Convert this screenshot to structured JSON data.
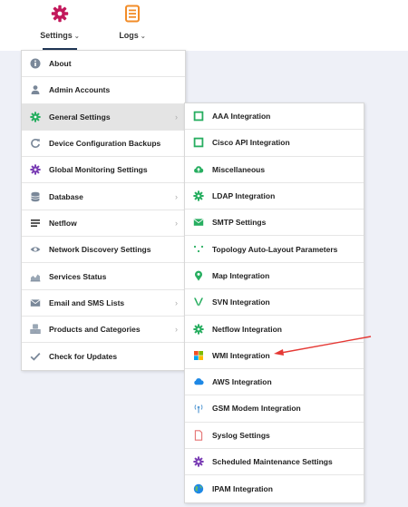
{
  "topnav": {
    "settings_label": "Settings",
    "logs_label": "Logs",
    "settings_icon": "gear-icon",
    "logs_icon": "document-icon",
    "accent_color": "#c2185b",
    "logs_color": "#f28c28"
  },
  "main_menu": {
    "items": [
      {
        "label": "About",
        "icon": "info-icon",
        "has_submenu": false
      },
      {
        "label": "Admin Accounts",
        "icon": "user-icon",
        "has_submenu": false
      },
      {
        "label": "General Settings",
        "icon": "gear-icon",
        "has_submenu": true,
        "selected": true
      },
      {
        "label": "Device Configuration Backups",
        "icon": "refresh-icon",
        "has_submenu": false
      },
      {
        "label": "Global Monitoring Settings",
        "icon": "gear-icon",
        "has_submenu": false
      },
      {
        "label": "Database",
        "icon": "database-icon",
        "has_submenu": true
      },
      {
        "label": "Netflow",
        "icon": "netflow-icon",
        "has_submenu": true
      },
      {
        "label": "Network Discovery Settings",
        "icon": "eye-icon",
        "has_submenu": false
      },
      {
        "label": "Services Status",
        "icon": "chart-icon",
        "has_submenu": false
      },
      {
        "label": "Email and SMS Lists",
        "icon": "envelope-icon",
        "has_submenu": true
      },
      {
        "label": "Products and Categories",
        "icon": "cubes-icon",
        "has_submenu": true
      },
      {
        "label": "Check for Updates",
        "icon": "check-icon",
        "has_submenu": false
      }
    ]
  },
  "sub_menu": {
    "items": [
      {
        "label": "AAA Integration",
        "icon": "square-icon"
      },
      {
        "label": "Cisco API Integration",
        "icon": "square-icon"
      },
      {
        "label": "Miscellaneous",
        "icon": "cloud-upload-icon"
      },
      {
        "label": "LDAP Integration",
        "icon": "gear-icon"
      },
      {
        "label": "SMTP Settings",
        "icon": "envelope-icon"
      },
      {
        "label": "Topology Auto-Layout Parameters",
        "icon": "dots-icon"
      },
      {
        "label": "Map Integration",
        "icon": "map-marker-icon"
      },
      {
        "label": "SVN Integration",
        "icon": "svn-icon"
      },
      {
        "label": "Netflow Integration",
        "icon": "gear-icon"
      },
      {
        "label": "WMI Integration",
        "icon": "windows-icon"
      },
      {
        "label": "AWS Integration",
        "icon": "cloud-icon"
      },
      {
        "label": "GSM Modem Integration",
        "icon": "antenna-icon"
      },
      {
        "label": "Syslog Settings",
        "icon": "file-icon"
      },
      {
        "label": "Scheduled Maintenance Settings",
        "icon": "gear-icon"
      },
      {
        "label": "IPAM Integration",
        "icon": "globe-icon"
      }
    ]
  }
}
